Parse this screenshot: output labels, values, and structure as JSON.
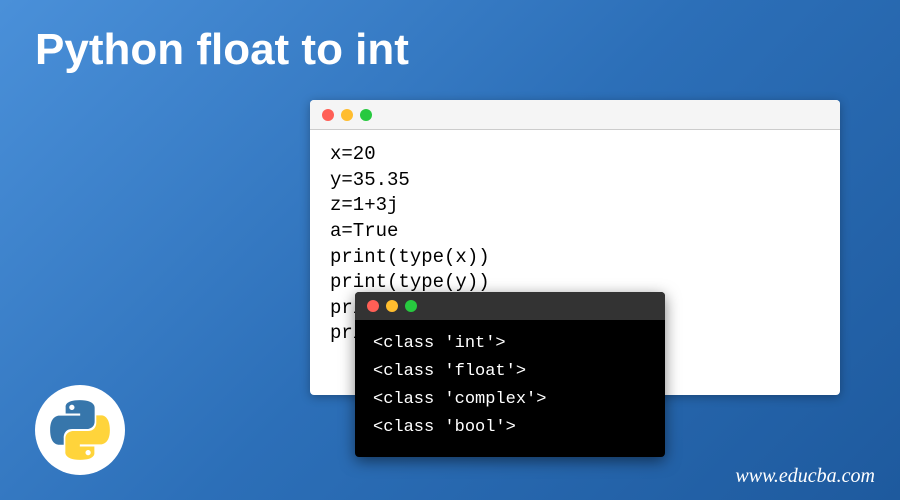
{
  "title": "Python float to int",
  "code_window": {
    "lines": [
      "x=20",
      "y=35.35",
      "z=1+3j",
      "a=True",
      "print(type(x))",
      "print(type(y))",
      "print(type(z))",
      "print(type(a))"
    ]
  },
  "terminal_window": {
    "lines": [
      "<class 'int'>",
      "<class 'float'>",
      "<class 'complex'>",
      "<class 'bool'>"
    ]
  },
  "watermark": "www.educba.com",
  "logo_name": "python-logo"
}
